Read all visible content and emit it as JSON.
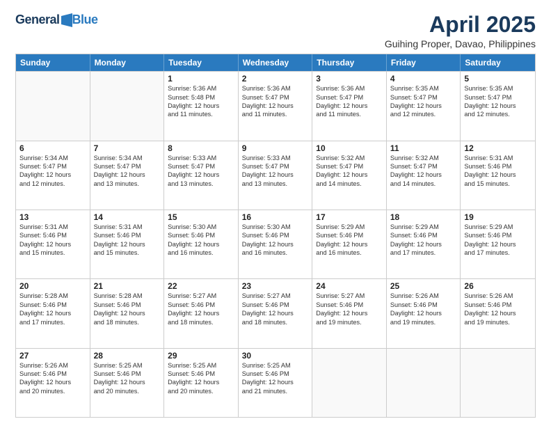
{
  "header": {
    "logo_general": "General",
    "logo_blue": "Blue",
    "month_title": "April 2025",
    "location": "Guihing Proper, Davao, Philippines"
  },
  "calendar": {
    "days_of_week": [
      "Sunday",
      "Monday",
      "Tuesday",
      "Wednesday",
      "Thursday",
      "Friday",
      "Saturday"
    ],
    "weeks": [
      [
        {
          "day": "",
          "info": ""
        },
        {
          "day": "",
          "info": ""
        },
        {
          "day": "1",
          "info": "Sunrise: 5:36 AM\nSunset: 5:48 PM\nDaylight: 12 hours\nand 11 minutes."
        },
        {
          "day": "2",
          "info": "Sunrise: 5:36 AM\nSunset: 5:47 PM\nDaylight: 12 hours\nand 11 minutes."
        },
        {
          "day": "3",
          "info": "Sunrise: 5:36 AM\nSunset: 5:47 PM\nDaylight: 12 hours\nand 11 minutes."
        },
        {
          "day": "4",
          "info": "Sunrise: 5:35 AM\nSunset: 5:47 PM\nDaylight: 12 hours\nand 12 minutes."
        },
        {
          "day": "5",
          "info": "Sunrise: 5:35 AM\nSunset: 5:47 PM\nDaylight: 12 hours\nand 12 minutes."
        }
      ],
      [
        {
          "day": "6",
          "info": "Sunrise: 5:34 AM\nSunset: 5:47 PM\nDaylight: 12 hours\nand 12 minutes."
        },
        {
          "day": "7",
          "info": "Sunrise: 5:34 AM\nSunset: 5:47 PM\nDaylight: 12 hours\nand 13 minutes."
        },
        {
          "day": "8",
          "info": "Sunrise: 5:33 AM\nSunset: 5:47 PM\nDaylight: 12 hours\nand 13 minutes."
        },
        {
          "day": "9",
          "info": "Sunrise: 5:33 AM\nSunset: 5:47 PM\nDaylight: 12 hours\nand 13 minutes."
        },
        {
          "day": "10",
          "info": "Sunrise: 5:32 AM\nSunset: 5:47 PM\nDaylight: 12 hours\nand 14 minutes."
        },
        {
          "day": "11",
          "info": "Sunrise: 5:32 AM\nSunset: 5:47 PM\nDaylight: 12 hours\nand 14 minutes."
        },
        {
          "day": "12",
          "info": "Sunrise: 5:31 AM\nSunset: 5:46 PM\nDaylight: 12 hours\nand 15 minutes."
        }
      ],
      [
        {
          "day": "13",
          "info": "Sunrise: 5:31 AM\nSunset: 5:46 PM\nDaylight: 12 hours\nand 15 minutes."
        },
        {
          "day": "14",
          "info": "Sunrise: 5:31 AM\nSunset: 5:46 PM\nDaylight: 12 hours\nand 15 minutes."
        },
        {
          "day": "15",
          "info": "Sunrise: 5:30 AM\nSunset: 5:46 PM\nDaylight: 12 hours\nand 16 minutes."
        },
        {
          "day": "16",
          "info": "Sunrise: 5:30 AM\nSunset: 5:46 PM\nDaylight: 12 hours\nand 16 minutes."
        },
        {
          "day": "17",
          "info": "Sunrise: 5:29 AM\nSunset: 5:46 PM\nDaylight: 12 hours\nand 16 minutes."
        },
        {
          "day": "18",
          "info": "Sunrise: 5:29 AM\nSunset: 5:46 PM\nDaylight: 12 hours\nand 17 minutes."
        },
        {
          "day": "19",
          "info": "Sunrise: 5:29 AM\nSunset: 5:46 PM\nDaylight: 12 hours\nand 17 minutes."
        }
      ],
      [
        {
          "day": "20",
          "info": "Sunrise: 5:28 AM\nSunset: 5:46 PM\nDaylight: 12 hours\nand 17 minutes."
        },
        {
          "day": "21",
          "info": "Sunrise: 5:28 AM\nSunset: 5:46 PM\nDaylight: 12 hours\nand 18 minutes."
        },
        {
          "day": "22",
          "info": "Sunrise: 5:27 AM\nSunset: 5:46 PM\nDaylight: 12 hours\nand 18 minutes."
        },
        {
          "day": "23",
          "info": "Sunrise: 5:27 AM\nSunset: 5:46 PM\nDaylight: 12 hours\nand 18 minutes."
        },
        {
          "day": "24",
          "info": "Sunrise: 5:27 AM\nSunset: 5:46 PM\nDaylight: 12 hours\nand 19 minutes."
        },
        {
          "day": "25",
          "info": "Sunrise: 5:26 AM\nSunset: 5:46 PM\nDaylight: 12 hours\nand 19 minutes."
        },
        {
          "day": "26",
          "info": "Sunrise: 5:26 AM\nSunset: 5:46 PM\nDaylight: 12 hours\nand 19 minutes."
        }
      ],
      [
        {
          "day": "27",
          "info": "Sunrise: 5:26 AM\nSunset: 5:46 PM\nDaylight: 12 hours\nand 20 minutes."
        },
        {
          "day": "28",
          "info": "Sunrise: 5:25 AM\nSunset: 5:46 PM\nDaylight: 12 hours\nand 20 minutes."
        },
        {
          "day": "29",
          "info": "Sunrise: 5:25 AM\nSunset: 5:46 PM\nDaylight: 12 hours\nand 20 minutes."
        },
        {
          "day": "30",
          "info": "Sunrise: 5:25 AM\nSunset: 5:46 PM\nDaylight: 12 hours\nand 21 minutes."
        },
        {
          "day": "",
          "info": ""
        },
        {
          "day": "",
          "info": ""
        },
        {
          "day": "",
          "info": ""
        }
      ]
    ]
  }
}
